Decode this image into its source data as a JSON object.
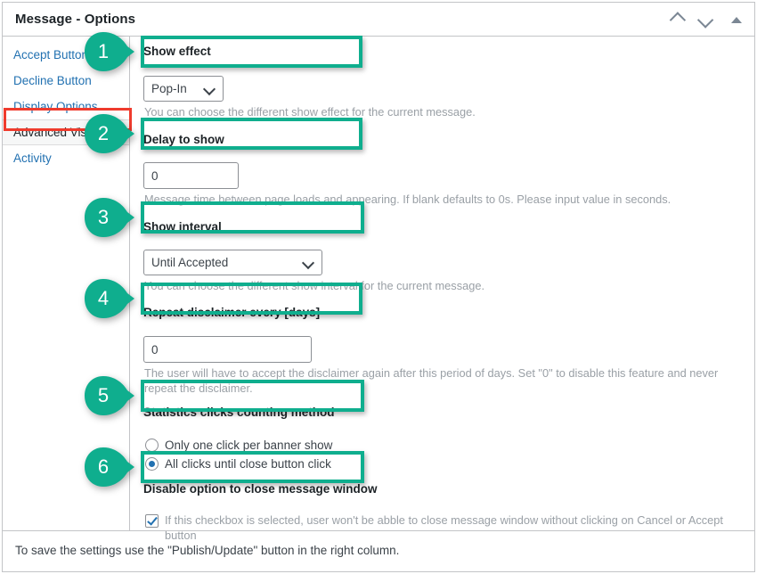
{
  "window": {
    "title": "Message - Options",
    "header_icons": [
      {
        "name": "move-up-icon",
        "glyph": "chevron-up"
      },
      {
        "name": "move-down-icon",
        "glyph": "chevron-down"
      },
      {
        "name": "toggle-panel-icon",
        "glyph": "triangle-up"
      }
    ]
  },
  "colors": {
    "highlight_teal": "#0fae8e",
    "highlight_red": "#ef3b2d",
    "link_blue": "#2271b1",
    "accent_blue": "#2271b1"
  },
  "sidebar": {
    "items": [
      {
        "label": "Accept Button",
        "active": false
      },
      {
        "label": "Decline Button",
        "active": false
      },
      {
        "label": "Display Options",
        "active": false
      },
      {
        "label": "Advanced Visual",
        "active": true
      },
      {
        "label": "Activity",
        "active": false
      }
    ]
  },
  "fields": {
    "show_effect": {
      "label": "Show effect",
      "value": "Pop-In",
      "options": [
        "Pop-In"
      ],
      "help": "You can choose the different show effect for the current message."
    },
    "delay_to_show": {
      "label": "Delay to show",
      "value": "0",
      "help": "Message time between page loads and appearing. If blank defaults to 0s. Please input value in seconds."
    },
    "show_interval": {
      "label": "Show interval",
      "value": "Until Accepted",
      "options": [
        "Until Accepted"
      ],
      "help": "You can choose the different show interval for the current message."
    },
    "repeat_disclaimer": {
      "label": "Repeat disclaimer every [days]",
      "value": "0",
      "help": "The user will have to accept the disclaimer again after this period of days. Set \"0\" to disable this feature and never repeat the disclaimer."
    },
    "statistics_clicks": {
      "label": "Statistics clicks counting method",
      "options": [
        {
          "label": "Only one click per banner show",
          "selected": false
        },
        {
          "label": "All clicks until close button click",
          "selected": true
        }
      ]
    },
    "disable_close": {
      "label": "Disable option to close message window",
      "checkbox_checked": true,
      "checkbox_label": "If this checkbox is selected, user won't be abble to close message window without clicking on Cancel or Accept button"
    }
  },
  "footer": {
    "text": "To save the settings use the \"Publish/Update\" button in the right column."
  },
  "annotations": {
    "pins": [
      {
        "number": "1",
        "target": "show-effect-label"
      },
      {
        "number": "2",
        "target": "sidebar-item-advanced-visual"
      },
      {
        "number": "3",
        "target": "show-interval-label"
      },
      {
        "number": "4",
        "target": "repeat-disclaimer-label"
      },
      {
        "number": "5",
        "target": "statistics-clicks-label"
      },
      {
        "number": "6",
        "target": "disable-close-label"
      }
    ]
  }
}
